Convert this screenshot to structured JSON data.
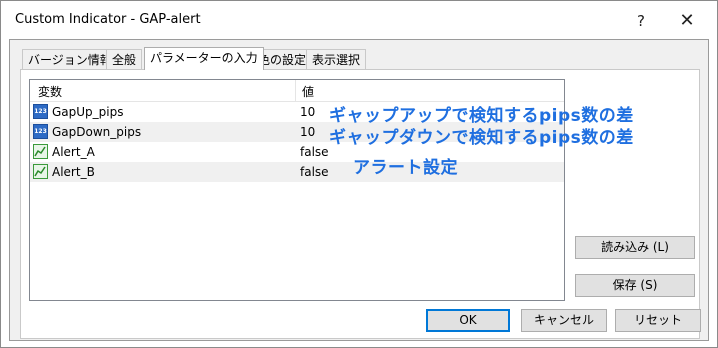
{
  "window": {
    "title": "Custom Indicator - GAP-alert",
    "help": "?",
    "close": "✕"
  },
  "tabs": [
    {
      "label": "バージョン情報"
    },
    {
      "label": "全般"
    },
    {
      "label": "パラメーターの入力"
    },
    {
      "label": "色の設定"
    },
    {
      "label": "表示選択"
    }
  ],
  "table": {
    "columns": {
      "variable": "変数",
      "value": "値"
    },
    "rows": [
      {
        "icon": "number-param-icon",
        "icon_text": "123",
        "name": "GapUp_pips",
        "value": "10"
      },
      {
        "icon": "number-param-icon",
        "icon_text": "123",
        "name": "GapDown_pips",
        "value": "10"
      },
      {
        "icon": "alert-param-icon",
        "name": "Alert_A",
        "value": "false"
      },
      {
        "icon": "alert-param-icon",
        "name": "Alert_B",
        "value": "false"
      }
    ]
  },
  "annotations": {
    "gap_up": "ギャップアップで検知するpips数の差",
    "gap_down": "ギャップダウンで検知するpips数の差",
    "alert": "アラート設定"
  },
  "buttons": {
    "load": "読み込み (L)",
    "save": "保存 (S)",
    "ok": "OK",
    "cancel": "キャンセル",
    "reset": "リセット"
  },
  "colors": {
    "annotation": "#1f6fe0",
    "ok_border": "#0078d7"
  }
}
